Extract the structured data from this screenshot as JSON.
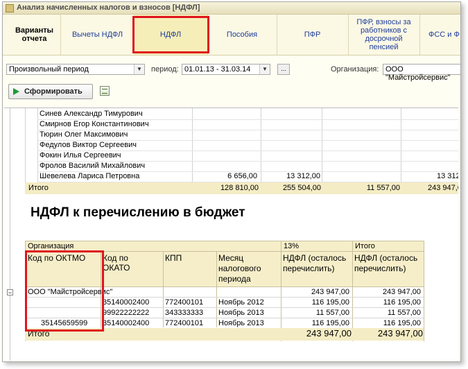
{
  "window": {
    "title": "Анализ начисленных налогов и взносов [НДФЛ]"
  },
  "tabs": [
    {
      "label": "Варианты отчета"
    },
    {
      "label": "Вычеты НДФЛ"
    },
    {
      "label": "НДФЛ"
    },
    {
      "label": "Пособия"
    },
    {
      "label": "ПФР"
    },
    {
      "label": "ПФР, взносы за работников с досрочной пенсией"
    },
    {
      "label": "ФСС и Ф"
    }
  ],
  "filters": {
    "period_type": "Произвольный период",
    "period_label": "период:",
    "period_value": "01.01.13 - 31.03.14",
    "dots": "...",
    "org_label": "Организация:",
    "org_value": "ООО \"Майстройсервис\""
  },
  "toolbar": {
    "generate_label": "Сформировать"
  },
  "upper_table": {
    "rows": [
      {
        "name": "Синев Александр Тимурович",
        "c1": "",
        "c2": "",
        "c3": "",
        "c4": ""
      },
      {
        "name": "Смирнов Егор Константинович",
        "c1": "",
        "c2": "",
        "c3": "",
        "c4": ""
      },
      {
        "name": "Тюрин Олег Максимович",
        "c1": "",
        "c2": "",
        "c3": "",
        "c4": ""
      },
      {
        "name": "Федулов Виктор Сергеевич",
        "c1": "",
        "c2": "",
        "c3": "",
        "c4": ""
      },
      {
        "name": "Фокин Илья Сергеевич",
        "c1": "",
        "c2": "",
        "c3": "",
        "c4": ""
      },
      {
        "name": "Фролов Василий Михайлович",
        "c1": "",
        "c2": "",
        "c3": "",
        "c4": ""
      },
      {
        "name": "Шевелева Лариса Петровна",
        "c1": "6 656,00",
        "c2": "13 312,00",
        "c3": "",
        "c4": "13 312,"
      }
    ],
    "total": {
      "label": "Итого",
      "c1": "128 810,00",
      "c2": "255 504,00",
      "c3": "11 557,00",
      "c4": "243 947,0"
    }
  },
  "section_title": "НДФЛ к перечислению в бюджет",
  "lower_table": {
    "header_org": "Организация",
    "header_13": "13%",
    "header_itogo": "Итого",
    "headers": {
      "oktmo": "Код по ОКТМО",
      "okato": "Код по ОКАТО",
      "kpp": "КПП",
      "month": "Месяц налогового периода",
      "ndfl13": "НДФЛ (осталось перечислить)",
      "ndfl_total": "НДФЛ (осталось перечислить)"
    },
    "org_row": {
      "name": "ООО \"Майстройсервис\"",
      "v13": "243 947,00",
      "vt": "243 947,00"
    },
    "rows": [
      {
        "oktmo": "",
        "okato": "35140002400",
        "kpp": "772400101",
        "month": "Ноябрь 2012",
        "v13": "116 195,00",
        "vt": "116 195,00"
      },
      {
        "oktmo": "",
        "okato": "99922222222",
        "kpp": "343333333",
        "month": "Ноябрь 2013",
        "v13": "11 557,00",
        "vt": "11 557,00"
      },
      {
        "oktmo": "35145659599",
        "okato": "35140002400",
        "kpp": "772400101",
        "month": "Ноябрь 2013",
        "v13": "116 195,00",
        "vt": "116 195,00"
      }
    ],
    "total": {
      "label": "Итого",
      "v13": "243 947,00",
      "vt": "243 947,00"
    },
    "tree_toggle": "−"
  }
}
